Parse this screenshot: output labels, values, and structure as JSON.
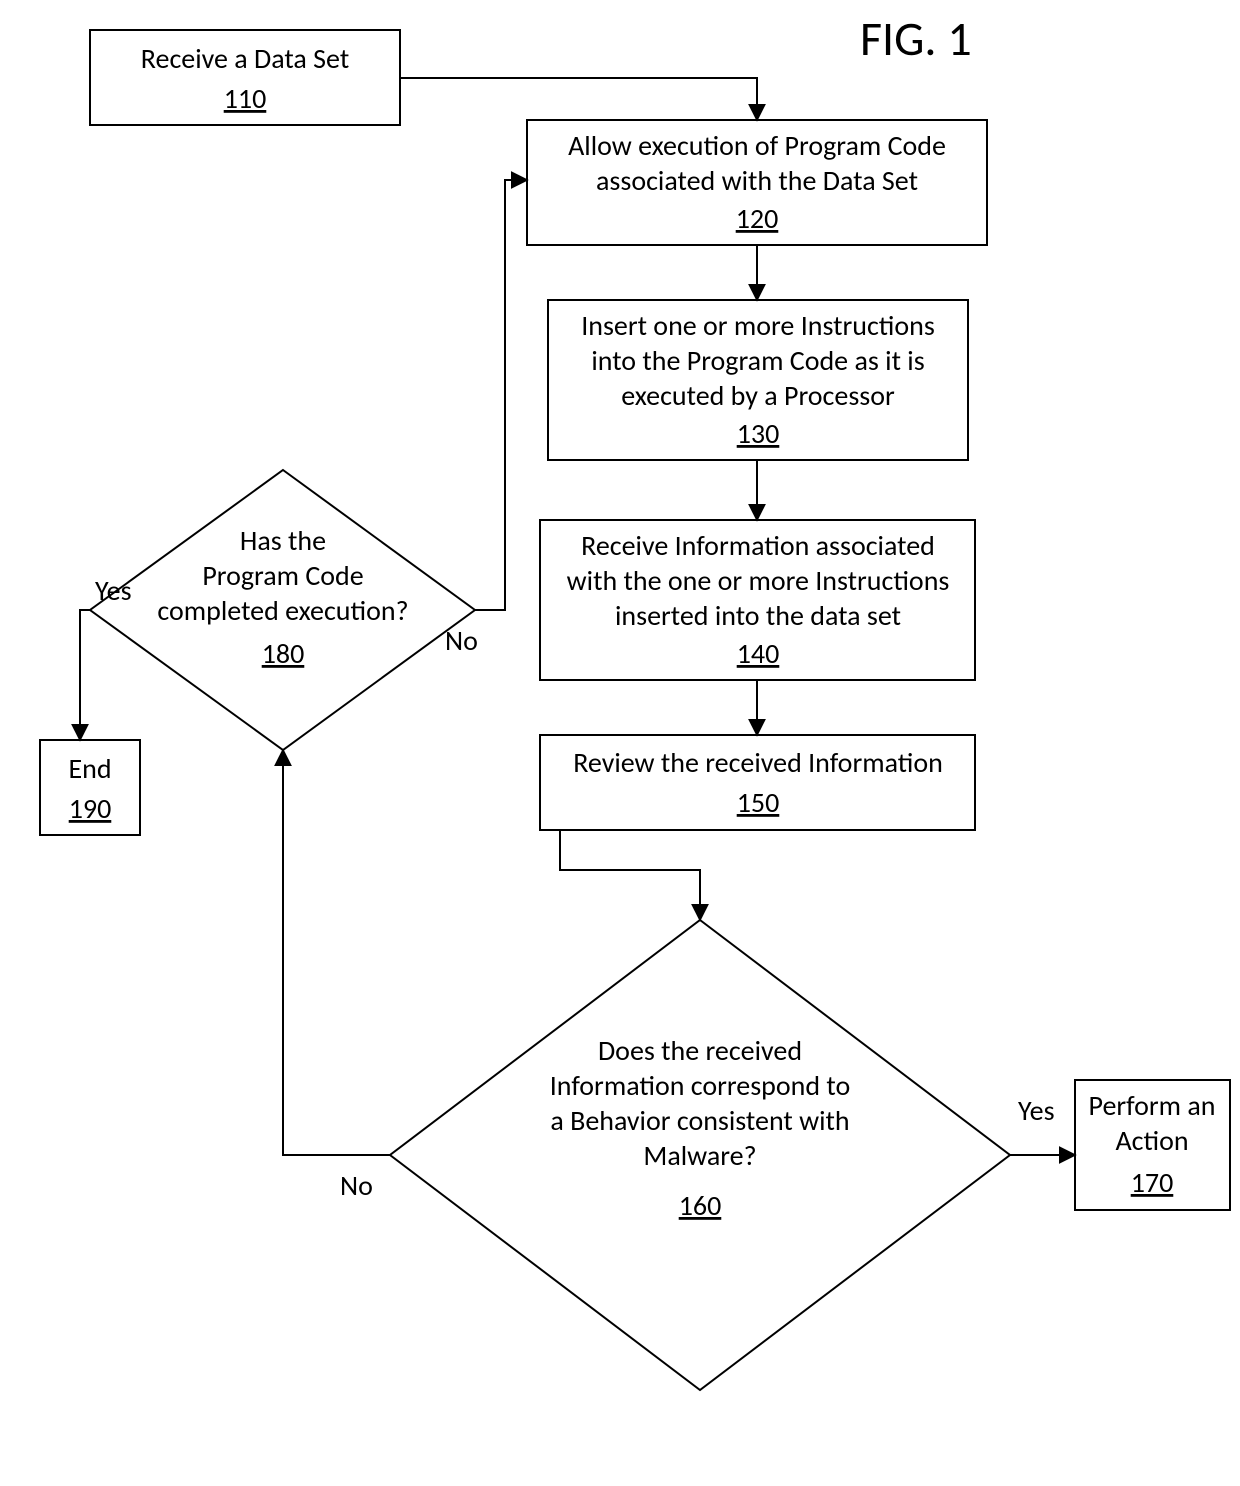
{
  "figureLabel": "FIG. 1",
  "nodes": {
    "n110": {
      "text": "Receive a Data Set",
      "num": "110"
    },
    "n120": {
      "text1": "Allow execution of Program Code",
      "text2": "associated with the Data Set",
      "num": "120"
    },
    "n130": {
      "text1": "Insert  one or more Instructions",
      "text2": "into the Program Code as it is",
      "text3": "executed by a Processor",
      "num": "130"
    },
    "n140": {
      "text1": "Receive Information associated",
      "text2": "with the one or more Instructions",
      "text3": "inserted into the data set",
      "num": "140"
    },
    "n150": {
      "text": "Review the received Information",
      "num": "150"
    },
    "n160": {
      "text1": "Does the received",
      "text2": "Information correspond to",
      "text3": "a Behavior consistent with",
      "text4": "Malware?",
      "num": "160"
    },
    "n170": {
      "text1": "Perform an",
      "text2": "Action",
      "num": "170"
    },
    "n180": {
      "text1": "Has the",
      "text2": "Program Code",
      "text3": "completed execution?",
      "num": "180"
    },
    "n190": {
      "text": "End",
      "num": "190"
    }
  },
  "labels": {
    "yes160": "Yes",
    "no160": "No",
    "yes180": "Yes",
    "no180": "No"
  }
}
